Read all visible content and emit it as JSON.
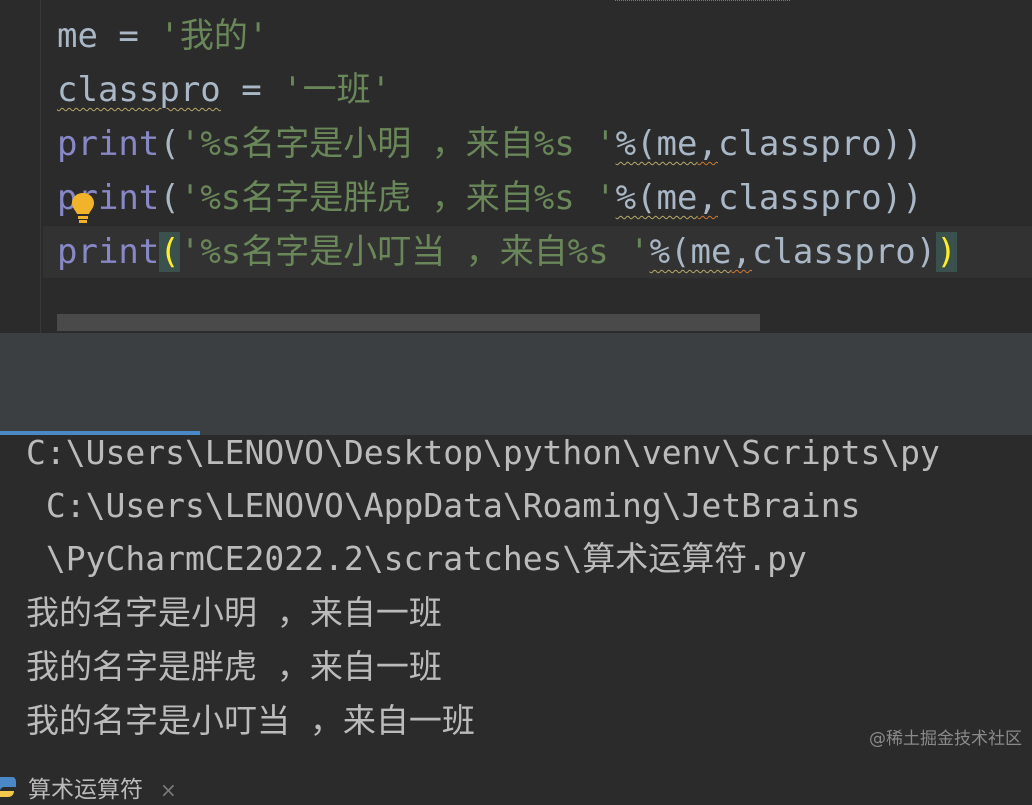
{
  "editor": {
    "lines": [
      {
        "var": "me",
        "op": " = ",
        "value": "'我的'"
      },
      {
        "var": "classpro",
        "op": " = ",
        "value": "'一班'"
      },
      {
        "fn": "print",
        "open": "(",
        "str": "'%s名字是小明 ，来自%s '",
        "fmt": "%(me",
        "comma": ",",
        "arg": "classpro",
        "close": "))"
      },
      {
        "fn": "print",
        "open": "(",
        "str": "'%s名字是胖虎 ，来自%s '",
        "fmt": "%(me",
        "comma": ",",
        "arg": "classpro",
        "close": "))"
      },
      {
        "fn": "print",
        "open": "(",
        "str": "'%s名字是小叮当 ，来自%s '",
        "fmt": "%(me",
        "comma": ",",
        "arg": "classpro",
        "close_inner": ")",
        "close": ")"
      }
    ]
  },
  "run_tab": {
    "label": "算术运算符",
    "close": "×"
  },
  "console": {
    "lines": [
      "C:\\Users\\LENOVO\\Desktop\\python\\venv\\Scripts\\py",
      " C:\\Users\\LENOVO\\AppData\\Roaming\\JetBrains",
      " \\PyCharmCE2022.2\\scratches\\算术运算符.py",
      "我的名字是小明 ，来自一班",
      "我的名字是胖虎 ，来自一班",
      "我的名字是小叮当 ，来自一班"
    ]
  },
  "watermark": "@稀土掘金技术社区",
  "colors": {
    "background": "#2b2b2b",
    "function": "#8888c6",
    "string": "#6a8759",
    "text": "#a9b7c6",
    "console_text": "#bbbbbb",
    "tab_accent": "#4a88c7"
  }
}
